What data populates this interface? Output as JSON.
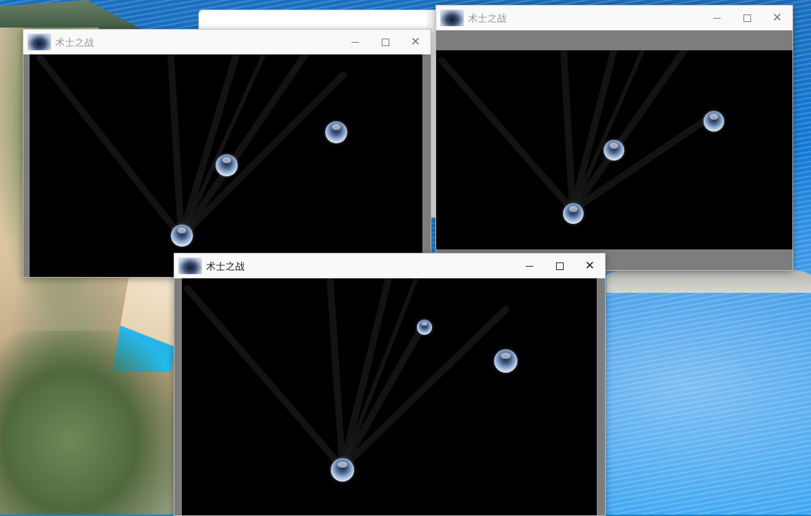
{
  "desktop": {
    "wallpaper": "coastal cliffs and sea"
  },
  "windows": [
    {
      "id": "game-window-1",
      "title": "术士之战",
      "active": false,
      "controls": {
        "minimize": "minimize-icon",
        "maximize": "maximize-icon",
        "close": "close-icon"
      },
      "orbs": 3
    },
    {
      "id": "game-window-2",
      "title": "术士之战",
      "active": false,
      "controls": {
        "minimize": "minimize-icon",
        "maximize": "maximize-icon",
        "close": "close-icon"
      },
      "orbs": 3
    },
    {
      "id": "game-window-3",
      "title": "术士之战",
      "active": true,
      "controls": {
        "minimize": "minimize-icon",
        "maximize": "maximize-icon",
        "close": "close-icon"
      },
      "orbs": 3
    }
  ],
  "colors": {
    "game_background": "#000000",
    "letterbox": "#7d7d7d",
    "titlebar": "#f9f9f9",
    "orb": "#9fb4d6"
  }
}
